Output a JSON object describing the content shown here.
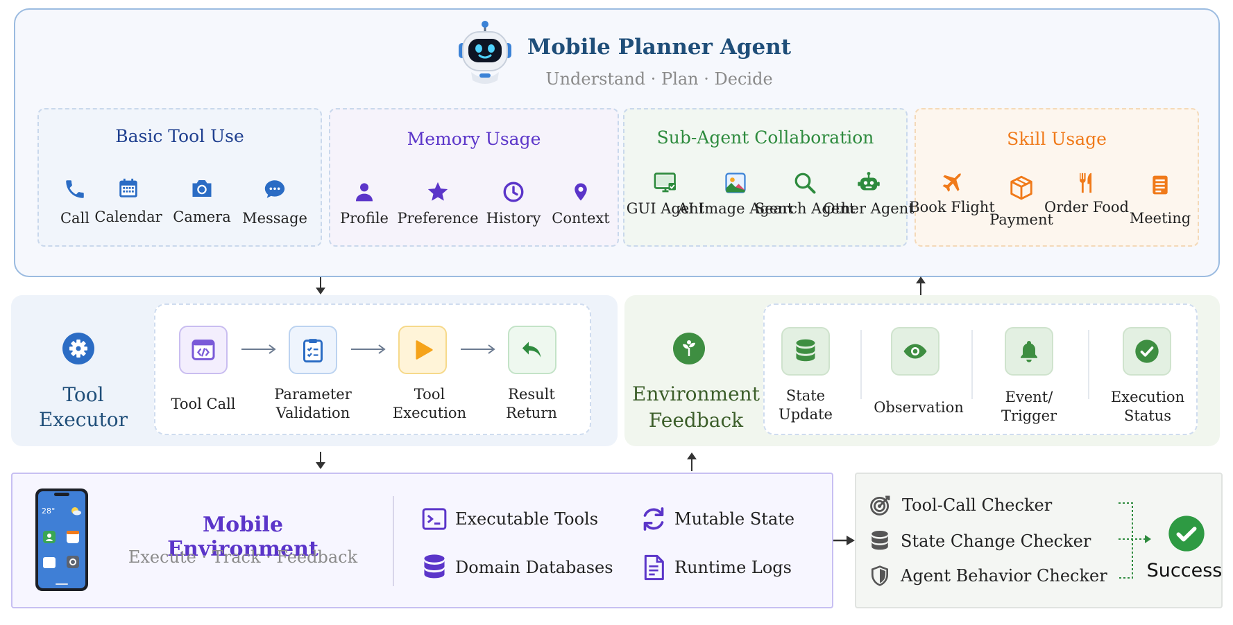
{
  "planner": {
    "title": "Mobile Planner Agent",
    "subtitle": "Understand · Plan · Decide",
    "categories": [
      {
        "title": "Basic Tool Use",
        "color": "#1f3f8f",
        "items": [
          "Call",
          "Calendar",
          "Camera",
          "Message"
        ]
      },
      {
        "title": "Memory Usage",
        "color": "#5b35c9",
        "items": [
          "Profile",
          "Preference",
          "History",
          "Context"
        ]
      },
      {
        "title": "Sub-Agent Collaboration",
        "color": "#2e8b3e",
        "items": [
          "GUI Agent",
          "AI Image Agent",
          "Search Agent",
          "Other Agent"
        ]
      },
      {
        "title": "Skill Usage",
        "color": "#f07a1a",
        "items": [
          "Book Flight",
          "Payment",
          "Order Food",
          "Meeting"
        ]
      }
    ]
  },
  "tool_executor": {
    "title": "Tool Executor",
    "steps": [
      "Tool Call",
      "Parameter Validation",
      "Tool Execution",
      "Result Return"
    ]
  },
  "environment_feedback": {
    "title": "Environment Feedback",
    "items": [
      "State Update",
      "Observation",
      "Event/ Trigger",
      "Execution Status"
    ]
  },
  "mobile_environment": {
    "title": "Mobile Environment",
    "subtitle": "Execute · Track · Feedback",
    "phone_time": "28°",
    "features": [
      "Executable Tools",
      "Mutable State",
      "Domain Databases",
      "Runtime Logs"
    ]
  },
  "checkers": {
    "items": [
      "Tool-Call Checker",
      "State Change Checker",
      "Agent Behavior Checker"
    ],
    "result": "Success"
  },
  "colors": {
    "blue": "#2b6cc4",
    "purple": "#5b35c9",
    "green": "#2e8b3e",
    "orange": "#f07a1a",
    "navy": "#1f4e79"
  }
}
